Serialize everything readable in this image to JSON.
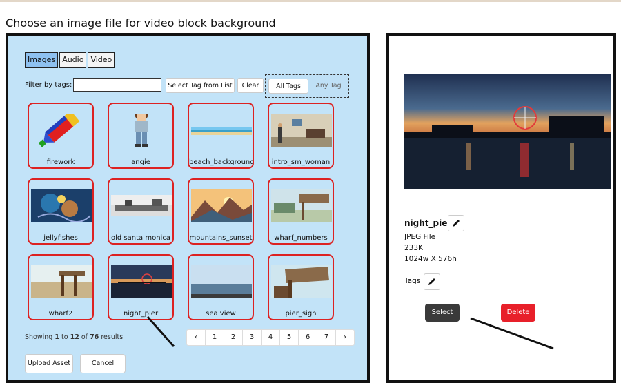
{
  "heading": "Choose an image file for video block background",
  "media_tabs": [
    {
      "label": "Images",
      "active": true
    },
    {
      "label": "Audio",
      "active": false
    },
    {
      "label": "Video",
      "active": false
    }
  ],
  "filter": {
    "label": "Filter by tags:",
    "value": "",
    "select_tag_label": "Select Tag from List",
    "clear_label": "Clear",
    "all_tags_label": "All Tags",
    "any_tag_label": "Any Tag"
  },
  "assets": [
    {
      "name": "firework",
      "thumb": "firework-sprite"
    },
    {
      "name": "angie",
      "thumb": "character-sprite"
    },
    {
      "name": "beach_background",
      "thumb": "beach-strip"
    },
    {
      "name": "intro_sm_woman",
      "thumb": "office-room"
    },
    {
      "name": "jellyfishes",
      "thumb": "jellyfish-art"
    },
    {
      "name": "old santa monica",
      "thumb": "bw-pier-photo"
    },
    {
      "name": "mountains_sunset",
      "thumb": "mountain-sunset"
    },
    {
      "name": "wharf_numbers",
      "thumb": "wharf-sign"
    },
    {
      "name": "wharf2",
      "thumb": "wharf-pier"
    },
    {
      "name": "night_pier",
      "thumb": "night-pier-photo"
    },
    {
      "name": "sea view",
      "thumb": "sea-photo"
    },
    {
      "name": "pier_sign",
      "thumb": "wooden-sign"
    }
  ],
  "results": {
    "prefix": "Showing",
    "from": "1",
    "to_word": "to",
    "to": "12",
    "of_word": "of",
    "total": "76",
    "suffix": "results"
  },
  "pagination": {
    "prev": "‹",
    "pages": [
      "1",
      "2",
      "3",
      "4",
      "5",
      "6",
      "7"
    ],
    "next": "›"
  },
  "buttons": {
    "upload": "Upload Asset",
    "cancel": "Cancel",
    "select": "Select",
    "delete": "Delete"
  },
  "selected_asset": {
    "name": "night_pier",
    "type": "JPEG File",
    "size": "233K",
    "dimensions": "1024w X 576h",
    "tags_label": "Tags"
  },
  "icons": {
    "edit": "pencil-icon"
  },
  "colors": {
    "panel_bg": "#c2e3f8",
    "tile_border": "#dd2222",
    "active_tab": "#8ec1f0",
    "select_btn": "#3a3a3a",
    "delete_btn": "#e8202a"
  }
}
